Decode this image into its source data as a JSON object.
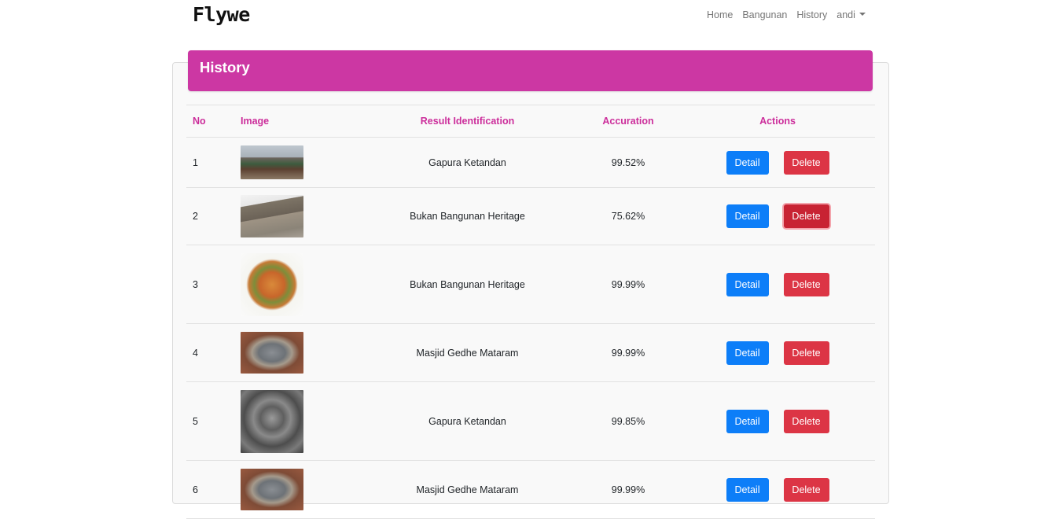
{
  "nav": {
    "brand": "Flywe",
    "links": [
      "Home",
      "Bangunan",
      "History"
    ],
    "user": "andi"
  },
  "card": {
    "title": "History"
  },
  "table": {
    "headers": [
      "No",
      "Image",
      "Result Identification",
      "Accuration",
      "Actions"
    ],
    "rows": [
      {
        "no": "1",
        "result": "Gapura Ketandan",
        "accuration": "99.52%",
        "detail": "Detail",
        "delete": "Delete"
      },
      {
        "no": "2",
        "result": "Bukan Bangunan Heritage",
        "accuration": "75.62%",
        "detail": "Detail",
        "delete": "Delete"
      },
      {
        "no": "3",
        "result": "Bukan Bangunan Heritage",
        "accuration": "99.99%",
        "detail": "Detail",
        "delete": "Delete"
      },
      {
        "no": "4",
        "result": "Masjid Gedhe Mataram",
        "accuration": "99.99%",
        "detail": "Detail",
        "delete": "Delete"
      },
      {
        "no": "5",
        "result": "Gapura Ketandan",
        "accuration": "99.85%",
        "detail": "Detail",
        "delete": "Delete"
      },
      {
        "no": "6",
        "result": "Masjid Gedhe Mataram",
        "accuration": "99.99%",
        "detail": "Detail",
        "delete": "Delete"
      }
    ]
  },
  "colors": {
    "accent": "#cc37a3",
    "header_text": "#cc2e9b",
    "detail_button": "#0d7ef8",
    "delete_button": "#dc3545"
  }
}
